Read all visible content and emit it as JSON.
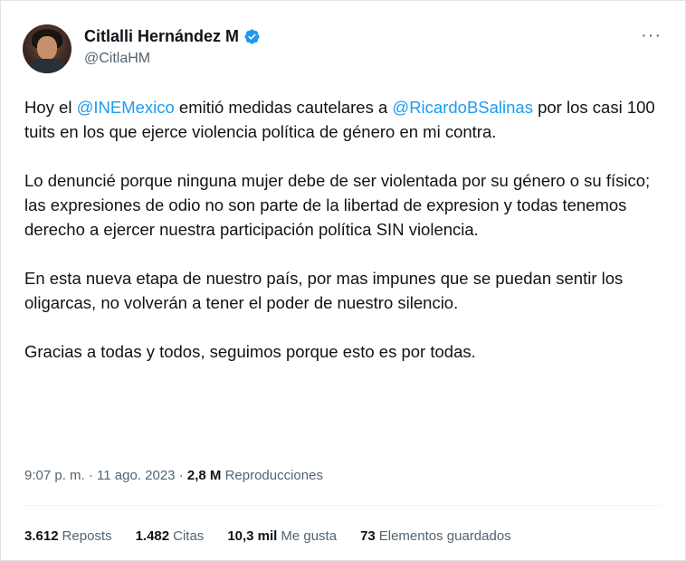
{
  "author": {
    "display_name": "Citlalli Hernández M",
    "handle": "@CitlaHM",
    "verified": true
  },
  "more_menu_label": "···",
  "tweet": {
    "paragraphs": [
      {
        "t1": "Hoy el ",
        "m1": "@INEMexico",
        "t2": " emitió medidas cautelares a ",
        "m2": "@RicardoBSalinas",
        "t3": " por los casi 100 tuits en los que ejerce violencia política de género en mi contra."
      },
      {
        "text": "Lo denuncié porque ninguna mujer debe de ser violentada por su género o su físico; las expresiones de odio no son parte de la libertad de expresion y todas tenemos derecho a ejercer nuestra participación política SIN violencia."
      },
      {
        "text": "En esta nueva etapa de nuestro país, por mas impunes que se puedan sentir los oligarcas, no volverán a tener el poder de nuestro silencio."
      },
      {
        "text": "Gracias a todas y todos, seguimos porque esto es por todas."
      }
    ]
  },
  "meta": {
    "time": "9:07 p. m.",
    "separator": " · ",
    "date": "11 ago. 2023",
    "views_count": "2,8 M",
    "views_label": "Reproducciones"
  },
  "stats": {
    "reposts": {
      "count": "3.612",
      "label": "Reposts"
    },
    "quotes": {
      "count": "1.482",
      "label": "Citas"
    },
    "likes": {
      "count": "10,3 mil",
      "label": "Me gusta"
    },
    "bookmarks": {
      "count": "73",
      "label": "Elementos guardados"
    }
  },
  "colors": {
    "link": "#1d9bf0",
    "text": "#0f1419",
    "secondary": "#536471",
    "verified_badge": "#1d9bf0"
  }
}
